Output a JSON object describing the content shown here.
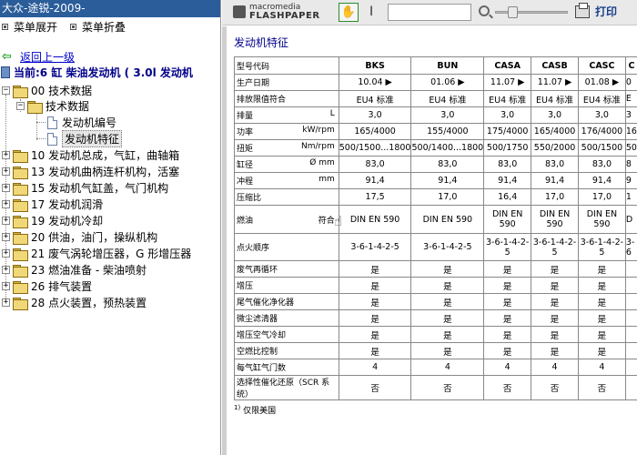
{
  "left_panel": {
    "title": "大众-途锐-2009-",
    "menu": [
      {
        "label": "菜单展开"
      },
      {
        "label": "菜单折叠"
      }
    ],
    "back_link": "返回上一级",
    "current": "当前:6 缸  柴油发动机 ( 3.0l 发动机",
    "tree": [
      {
        "label": "00 技术数据",
        "expanded": true
      },
      {
        "label": "技术数据",
        "expanded": true
      },
      {
        "label": "发动机编号"
      },
      {
        "label": "发动机特征",
        "selected": true
      },
      {
        "label": "10 发动机总成，气缸，曲轴箱"
      },
      {
        "label": "13 发动机曲柄连杆机构，活塞"
      },
      {
        "label": "15 发动机气缸盖，气门机构"
      },
      {
        "label": "17 发动机润滑"
      },
      {
        "label": "19 发动机冷却"
      },
      {
        "label": "20 供油，油门，操纵机构"
      },
      {
        "label": "21 废气涡轮增压器，G 形增压器"
      },
      {
        "label": "23 燃油准备 - 柴油喷射"
      },
      {
        "label": "26 排气装置"
      },
      {
        "label": "28 点火装置，预热装置"
      }
    ]
  },
  "viewer": {
    "logo_top": "macromedia",
    "logo_bottom": "FLASHPAPER",
    "print_label": "打印",
    "page_input_value": "",
    "icons": {
      "hand": "hand-tool-icon",
      "text": "text-select-icon",
      "zoom": "zoom-icon",
      "print": "printer-icon"
    }
  },
  "document": {
    "title": "发动机特征",
    "table": {
      "header_label": "型号代码",
      "columns": [
        "BKS",
        "BUN",
        "CASA",
        "CASB",
        "CASC",
        "C"
      ],
      "rows": [
        {
          "label": "生产日期",
          "unit": "",
          "values": [
            "10.04 ▶",
            "01.06 ▶",
            "11.07 ▶",
            "11.07 ▶",
            "01.08 ▶",
            "0"
          ]
        },
        {
          "label": "排放限值符合",
          "unit": "",
          "values": [
            "EU4 标准",
            "EU4 标准",
            "EU4 标准",
            "EU4 标准",
            "EU4 标准",
            "E"
          ]
        },
        {
          "label": "排量",
          "unit": "L",
          "values": [
            "3,0",
            "3,0",
            "3,0",
            "3,0",
            "3,0",
            "3"
          ]
        },
        {
          "label": "功率",
          "unit": "kW/rpm",
          "values": [
            "165/4000",
            "155/4000",
            "175/4000",
            "165/4000",
            "176/4000",
            "16"
          ]
        },
        {
          "label": "扭矩",
          "unit": "Nm/rpm",
          "values": [
            "500/1500...1800",
            "500/1400...1800",
            "500/1750",
            "550/2000",
            "500/1500",
            "50"
          ]
        },
        {
          "label": "缸径",
          "unit": "Ø mm",
          "values": [
            "83,0",
            "83,0",
            "83,0",
            "83,0",
            "83,0",
            "8"
          ]
        },
        {
          "label": "冲程",
          "unit": "mm",
          "values": [
            "91,4",
            "91,4",
            "91,4",
            "91,4",
            "91,4",
            "9"
          ]
        },
        {
          "label": "压缩比",
          "unit": "",
          "values": [
            "17,5",
            "17,0",
            "16,4",
            "17,0",
            "17,0",
            "1"
          ]
        },
        {
          "label": "燃油",
          "unit": "符合",
          "values": [
            "DIN EN 590",
            "DIN EN 590",
            "DIN EN 590",
            "DIN EN 590",
            "DIN EN 590",
            "D"
          ]
        },
        {
          "label": "点火顺序",
          "unit": "",
          "values": [
            "3-6-1-4-2-5",
            "3-6-1-4-2-5",
            "3-6-1-4-2-5",
            "3-6-1-4-2-5",
            "3-6-1-4-2-5",
            "3-6"
          ]
        },
        {
          "label": "废气再循环",
          "unit": "",
          "values": [
            "是",
            "是",
            "是",
            "是",
            "是",
            ""
          ]
        },
        {
          "label": "增压",
          "unit": "",
          "values": [
            "是",
            "是",
            "是",
            "是",
            "是",
            ""
          ]
        },
        {
          "label": "尾气催化净化器",
          "unit": "",
          "values": [
            "是",
            "是",
            "是",
            "是",
            "是",
            ""
          ]
        },
        {
          "label": "微尘滤清器",
          "unit": "",
          "values": [
            "是",
            "是",
            "是",
            "是",
            "是",
            ""
          ]
        },
        {
          "label": "增压空气冷却",
          "unit": "",
          "values": [
            "是",
            "是",
            "是",
            "是",
            "是",
            ""
          ]
        },
        {
          "label": "空燃比控制",
          "unit": "",
          "values": [
            "是",
            "是",
            "是",
            "是",
            "是",
            ""
          ]
        },
        {
          "label": "每气缸气门数",
          "unit": "",
          "values": [
            "4",
            "4",
            "4",
            "4",
            "4",
            ""
          ]
        },
        {
          "label": "选择性催化还原（SCR 系统）",
          "unit": "",
          "values": [
            "否",
            "否",
            "否",
            "否",
            "否",
            ""
          ]
        }
      ]
    },
    "footnote_mark": "1)",
    "footnote": "仅限美国"
  }
}
